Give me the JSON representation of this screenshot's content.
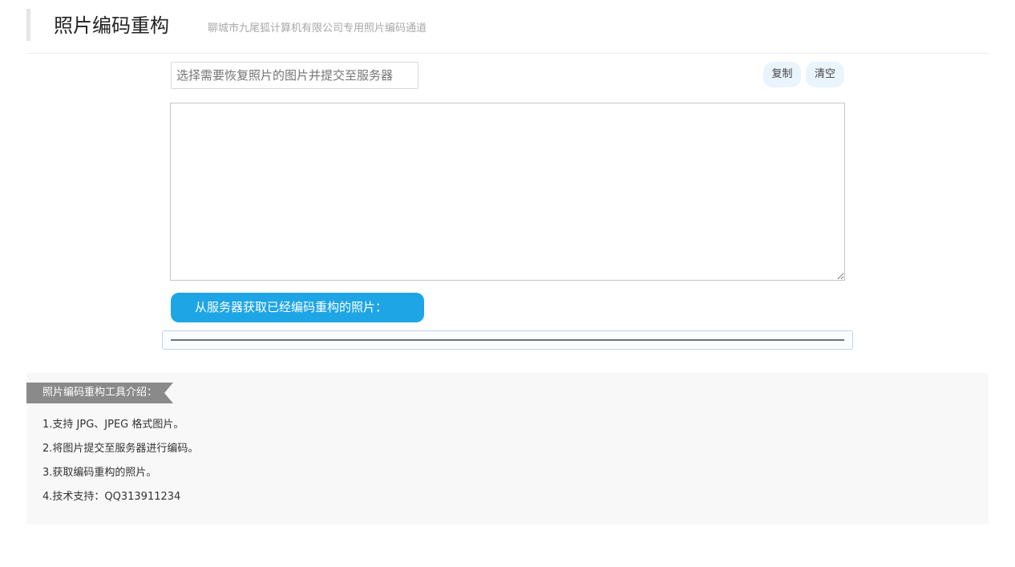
{
  "header": {
    "title": "照片编码重构",
    "subtitle": "聊城市九尾狐计算机有限公司专用照片编码通道"
  },
  "upload": {
    "placeholder": "选择需要恢复照片的图片并提交至服务器"
  },
  "actions": {
    "copy_label": "复制",
    "clear_label": "清空"
  },
  "code_area": {
    "value": ""
  },
  "fetch_button": {
    "label": "从服务器获取已经编码重构的照片："
  },
  "progress": {
    "fraction": 1.0
  },
  "intro": {
    "heading": "照片编码重构工具介绍：",
    "items": [
      "1.支持 JPG、JPEG 格式图片。",
      "2.将图片提交至服务器进行编码。",
      "3.获取编码重构的照片。",
      "4.技术支持：QQ313911234"
    ]
  },
  "colors": {
    "accent": "#1ea5e6",
    "button_bg": "#eaf4fd",
    "intro_tag_bg": "#8a8a8a",
    "intro_bg": "#f8f8f8",
    "progress_fill": "#6c7480"
  }
}
